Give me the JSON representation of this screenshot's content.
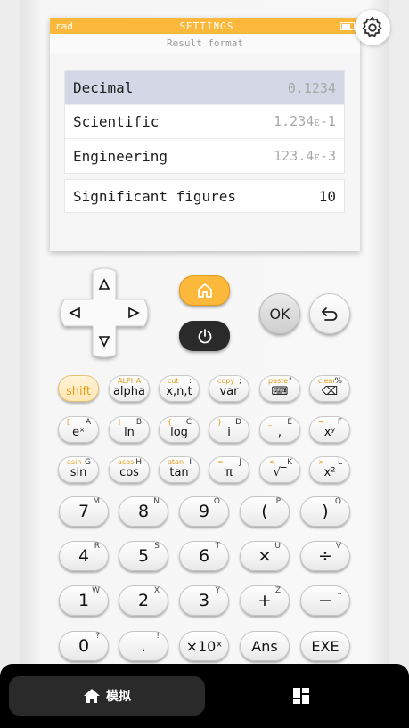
{
  "status_bar": {
    "left": "rad",
    "title": "SETTINGS"
  },
  "screen": {
    "subtitle": "Result format",
    "options": [
      {
        "label": "Decimal",
        "value": "0.1234",
        "selected": true
      },
      {
        "label": "Scientific",
        "value": "1.234ᴇ-1",
        "selected": false
      },
      {
        "label": "Engineering",
        "value": "123.4ᴇ-3",
        "selected": false
      }
    ],
    "sigfig": {
      "label": "Significant figures",
      "value": "10"
    }
  },
  "controls": {
    "ok_label": "OK"
  },
  "function_keys": [
    {
      "main": "shift",
      "sec": "",
      "alt": ""
    },
    {
      "main": "alpha",
      "sec": "ALPHA",
      "alt": ""
    },
    {
      "main": "x,n,t",
      "sec": "cut",
      "alt": ":"
    },
    {
      "main": "var",
      "sec": "copy",
      "alt": ";"
    },
    {
      "main": "⌨",
      "sec": "paste",
      "alt": "\""
    },
    {
      "main": "⌫",
      "sec": "clear",
      "alt": "%"
    },
    {
      "main": "eˣ",
      "sec": "[",
      "alt": "A"
    },
    {
      "main": "ln",
      "sec": "]",
      "alt": "B"
    },
    {
      "main": "log",
      "sec": "{",
      "alt": "C"
    },
    {
      "main": "i",
      "sec": "}",
      "alt": "D"
    },
    {
      "main": ",",
      "sec": "_",
      "alt": "E"
    },
    {
      "main": "xʸ",
      "sec": "→",
      "alt": "F"
    },
    {
      "main": "sin",
      "sec": "asin",
      "alt": "G"
    },
    {
      "main": "cos",
      "sec": "acos",
      "alt": "H"
    },
    {
      "main": "tan",
      "sec": "atan",
      "alt": "I"
    },
    {
      "main": "π",
      "sec": "=",
      "alt": "J"
    },
    {
      "main": "√‾",
      "sec": "<",
      "alt": "K"
    },
    {
      "main": "x²",
      "sec": ">",
      "alt": "L"
    }
  ],
  "number_keys": [
    {
      "main": "7",
      "alt": "M"
    },
    {
      "main": "8",
      "alt": "N"
    },
    {
      "main": "9",
      "alt": "O"
    },
    {
      "main": "(",
      "alt": "P"
    },
    {
      "main": ")",
      "alt": "Q"
    },
    {
      "main": "4",
      "alt": "R"
    },
    {
      "main": "5",
      "alt": "S"
    },
    {
      "main": "6",
      "alt": "T"
    },
    {
      "main": "×",
      "alt": "U"
    },
    {
      "main": "÷",
      "alt": "V"
    },
    {
      "main": "1",
      "alt": "W"
    },
    {
      "main": "2",
      "alt": "X"
    },
    {
      "main": "3",
      "alt": "Y"
    },
    {
      "main": "+",
      "alt": "Z"
    },
    {
      "main": "−",
      "alt": "⎵"
    },
    {
      "main": "0",
      "alt": "?"
    },
    {
      "main": ".",
      "alt": "!"
    },
    {
      "main": "×10ˣ",
      "alt": ""
    },
    {
      "main": "Ans",
      "alt": ""
    },
    {
      "main": "EXE",
      "alt": ""
    }
  ],
  "bottom_nav": {
    "simulate_label": "模拟"
  },
  "colors": {
    "accent": "#fbb83a",
    "selected_row": "#d4d8e6",
    "nav_bg": "#000000"
  },
  "icons": [
    "gear-icon",
    "home-icon",
    "power-icon",
    "undo-arrow-icon",
    "arrow-up-icon",
    "arrow-down-icon",
    "arrow-left-icon",
    "arrow-right-icon",
    "dashboard-icon",
    "battery-icon"
  ]
}
